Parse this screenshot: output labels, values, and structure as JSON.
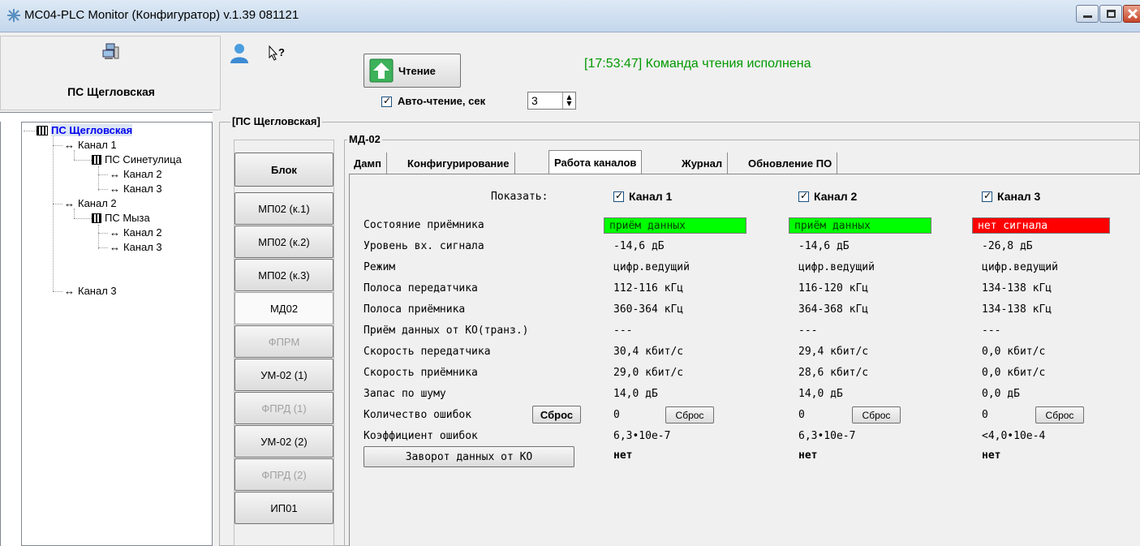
{
  "window": {
    "title": "МС04-PLC Monitor (Конфигуратор) v.1.39 081121"
  },
  "device_panel": {
    "name": "ПС Щегловская"
  },
  "toolbar": {
    "read_button": "Чтение",
    "auto_read_label": "Авто-чтение, сек",
    "auto_read_value": "3",
    "status_message": "[17:53:47] Команда чтения исполнена"
  },
  "tree": {
    "items": [
      {
        "label": "ПС Щегловская"
      },
      {
        "label": "Канал 1"
      },
      {
        "label": "ПС Синетулица"
      },
      {
        "label": "Канал 2"
      },
      {
        "label": "Канал 3"
      },
      {
        "label": "Канал 2"
      },
      {
        "label": "ПС Мыза"
      },
      {
        "label": "Канал 2"
      },
      {
        "label": "Канал 3"
      },
      {
        "label": "Канал 3"
      }
    ]
  },
  "blocks": {
    "group_title": "[ПС Щегловская]",
    "items": [
      {
        "label": "Блок"
      },
      {
        "label": "МП02 (к.1)"
      },
      {
        "label": "МП02 (к.2)"
      },
      {
        "label": "МП02 (к.3)"
      },
      {
        "label": "МД02"
      },
      {
        "label": "ФПРМ"
      },
      {
        "label": "УМ-02 (1)"
      },
      {
        "label": "ФПРД (1)"
      },
      {
        "label": "УМ-02 (2)"
      },
      {
        "label": "ФПРД (2)"
      },
      {
        "label": "ИП01"
      }
    ]
  },
  "md02": {
    "group_title": "МД-02",
    "tabs": [
      {
        "label": "Дамп"
      },
      {
        "label": "Конфигурирование"
      },
      {
        "label": "Работа каналов"
      },
      {
        "label": "Журнал"
      },
      {
        "label": "Обновление ПО"
      }
    ],
    "show_label": "Показать:",
    "channels": [
      {
        "label": "Канал 1",
        "state": "приём данных",
        "level": "-14,6 дБ",
        "mode": "цифр.ведущий",
        "tx_band": "112-116 кГц",
        "rx_band": "360-364 кГц",
        "rx_from_ko": "---",
        "tx_speed": "30,4 кбит/с",
        "rx_speed": "29,0 кбит/с",
        "noise_margin": "14,0 дБ",
        "errors": "0",
        "reset": "Сброс",
        "error_rate": "6,3•10e-7",
        "loopback": "нет"
      },
      {
        "label": "Канал 2",
        "state": "приём данных",
        "level": "-14,6 дБ",
        "mode": "цифр.ведущий",
        "tx_band": "116-120 кГц",
        "rx_band": "364-368 кГц",
        "rx_from_ko": "---",
        "tx_speed": "29,4 кбит/с",
        "rx_speed": "28,6 кбит/с",
        "noise_margin": "14,0 дБ",
        "errors": "0",
        "reset": "Сброс",
        "error_rate": "6,3•10e-7",
        "loopback": "нет"
      },
      {
        "label": "Канал 3",
        "state": "нет сигнала",
        "level": "-26,8 дБ",
        "mode": "цифр.ведущий",
        "tx_band": "134-138 кГц",
        "rx_band": "134-138 кГц",
        "rx_from_ko": "---",
        "tx_speed": "0,0 кбит/с",
        "rx_speed": "0,0 кбит/с",
        "noise_margin": "0,0 дБ",
        "errors": "0",
        "reset": "Сброс",
        "error_rate": "<4,0•10e-4",
        "loopback": "нет"
      }
    ],
    "rows": {
      "state": "Состояние приёмника",
      "level": "Уровень вх. сигнала",
      "mode": "Режим",
      "tx_band": "Полоса передатчика",
      "rx_band": "Полоса приёмника",
      "rx_from_ko": "Приём данных от КО(транз.)",
      "tx_speed": "Скорость передатчика",
      "rx_speed": "Скорость приёмника",
      "noise_margin": "Запас по шуму",
      "errors": "Количество ошибок",
      "error_rate": "Коэффициент ошибок"
    },
    "reset_all": "Сброс",
    "loopback_button": "Заворот данных от КО"
  },
  "colors": {
    "status_ok": "#00ff00",
    "status_bad": "#ff0000",
    "status_text_ok": "#009900"
  }
}
